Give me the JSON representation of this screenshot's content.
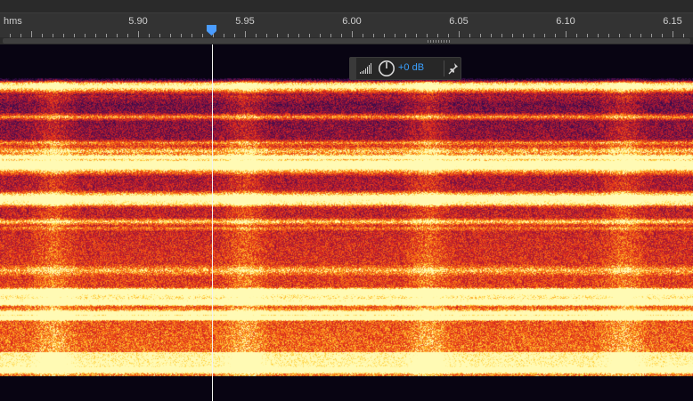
{
  "ruler": {
    "unit": "hms",
    "labels": [
      {
        "text": "5.90",
        "t": 5.9
      },
      {
        "text": "5.95",
        "t": 5.95
      },
      {
        "text": "6.00",
        "t": 6.0
      },
      {
        "text": "6.05",
        "t": 6.05
      },
      {
        "text": "6.10",
        "t": 6.1
      },
      {
        "text": "6.15",
        "t": 6.15
      }
    ]
  },
  "playhead": {
    "time": 5.9348,
    "color": "#4a9cff"
  },
  "hud": {
    "gain_label": "+0 dB",
    "gain_color": "#3aa0ff"
  },
  "icons": {
    "level_meter": "signal-bars-icon",
    "knob": "gain-knob-icon",
    "pin": "pin-icon",
    "marker": "playhead-marker-icon"
  }
}
